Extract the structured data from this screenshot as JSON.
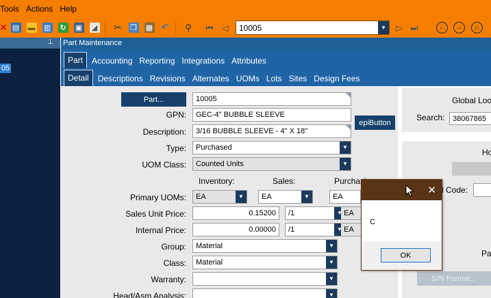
{
  "menu": {
    "items": [
      "Tools",
      "Actions",
      "Help"
    ]
  },
  "toolbar": {
    "record_value": "10005"
  },
  "left_panel": {
    "node_label": "05"
  },
  "window": {
    "title": "Part Maintenance"
  },
  "tabs": {
    "primary": [
      "Part",
      "Accounting",
      "Reporting",
      "Integrations",
      "Attributes"
    ],
    "secondary": [
      "Detail",
      "Descriptions",
      "Revisions",
      "Alternates",
      "UOMs",
      "Lots",
      "Sites",
      "Design Fees"
    ]
  },
  "form": {
    "part_button": "Part...",
    "part_value": "10005",
    "gpn_label": "GPN:",
    "gpn_value": "GEC-4\" BUBBLE SLEEVE",
    "epi_button": "epiButton",
    "description_label": "Description:",
    "description_value": "3/16 BUBBLE SLEEVE - 4\" X 18\"",
    "type_label": "Type:",
    "type_value": "Purchased",
    "uom_class_label": "UOM Class:",
    "uom_class_value": "Counted Units",
    "col_inventory": "Inventory:",
    "col_sales": "Sales:",
    "col_purchasing": "Purchasing:",
    "primary_uoms_label": "Primary UOMs:",
    "uom_inventory": "EA",
    "uom_sales": "EA",
    "uom_purchasing": "EA",
    "sales_unit_price_label": "Sales Unit Price:",
    "sales_unit_price_value": "0.15200",
    "sales_per": "/1",
    "sales_uom": "EA",
    "internal_price_label": "Internal Price:",
    "internal_price_value": "0.00000",
    "internal_per": "/1",
    "internal_uom": "EA",
    "group_label": "Group:",
    "group_value": "Material",
    "class_label": "Class:",
    "class_value": "Material",
    "warranty_label": "Warranty:",
    "warranty_value": "",
    "head_asm_label": "Head/Asm Analysis:",
    "head_asm_value": ""
  },
  "right_panel": {
    "global_lookup": "Global Loo",
    "search_label": "Search:",
    "search_value": "38067865",
    "ho_label": "Ho",
    "code_label": "l Code:",
    "pa_label": "Pa",
    "sn_button": "S/N Format..."
  },
  "message_box": {
    "message": "C",
    "ok_label": "OK"
  }
}
